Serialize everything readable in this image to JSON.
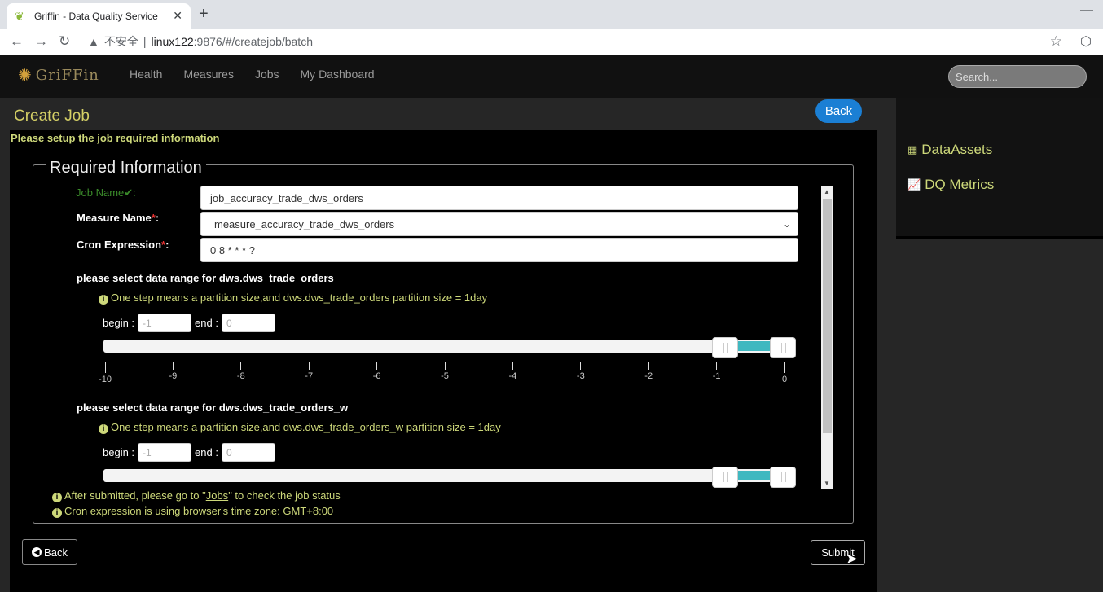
{
  "browser": {
    "tab_title": "Griffin - Data Quality Service",
    "security_label": "不安全",
    "url_host": "linux122",
    "url_path": ":9876/#/createjob/batch"
  },
  "nav": {
    "logo_text": "GriFFin",
    "links": [
      "Health",
      "Measures",
      "Jobs",
      "My Dashboard"
    ],
    "search_placeholder": "Search..."
  },
  "page": {
    "title": "Create Job",
    "back_label": "Back",
    "subtitle": "Please setup the job required information",
    "section_legend": "Required Information"
  },
  "form": {
    "job_name_label": "Job Name",
    "job_name_value": "job_accuracy_trade_dws_orders",
    "measure_name_label": "Measure Name",
    "measure_name_value": "measure_accuracy_trade_dws_orders",
    "cron_label": "Cron Expression",
    "cron_value": "0 8 * * * ?"
  },
  "ranges": [
    {
      "title": "please select data range for dws.dws_trade_orders",
      "info": "One step means a partition size,and dws.dws_trade_orders partition size = 1day",
      "begin_label": "begin :",
      "begin_value": "-1",
      "end_label": "end :",
      "end_value": "0",
      "ticks": [
        "-10",
        "-9",
        "-8",
        "-7",
        "-6",
        "-5",
        "-4",
        "-3",
        "-2",
        "-1",
        "0"
      ],
      "min": -10,
      "max": 0,
      "begin": -1,
      "end": 0
    },
    {
      "title": "please select data range for dws.dws_trade_orders_w",
      "info": "One step means a partition size,and dws.dws_trade_orders_w partition size = 1day",
      "begin_label": "begin :",
      "begin_value": "-1",
      "end_label": "end :",
      "end_value": "0",
      "min": -10,
      "max": 0,
      "begin": -1,
      "end": 0
    }
  ],
  "notes": {
    "submitted_pre": "After submitted, please go to \"",
    "submitted_link": "Jobs",
    "submitted_post": "\" to check the job status",
    "timezone": "Cron expression is using browser's time zone: GMT+8:00"
  },
  "actions": {
    "back_label": "Back",
    "submit_label": "Submit"
  },
  "sidebar": {
    "items": [
      {
        "label": "DataAssets",
        "icon": "table-icon"
      },
      {
        "label": "DQ Metrics",
        "icon": "line-chart-icon"
      }
    ]
  },
  "colors": {
    "accent_text": "#cdd87a",
    "slider_fill": "#3fb8c0",
    "back_pill": "#1b7fd4"
  }
}
